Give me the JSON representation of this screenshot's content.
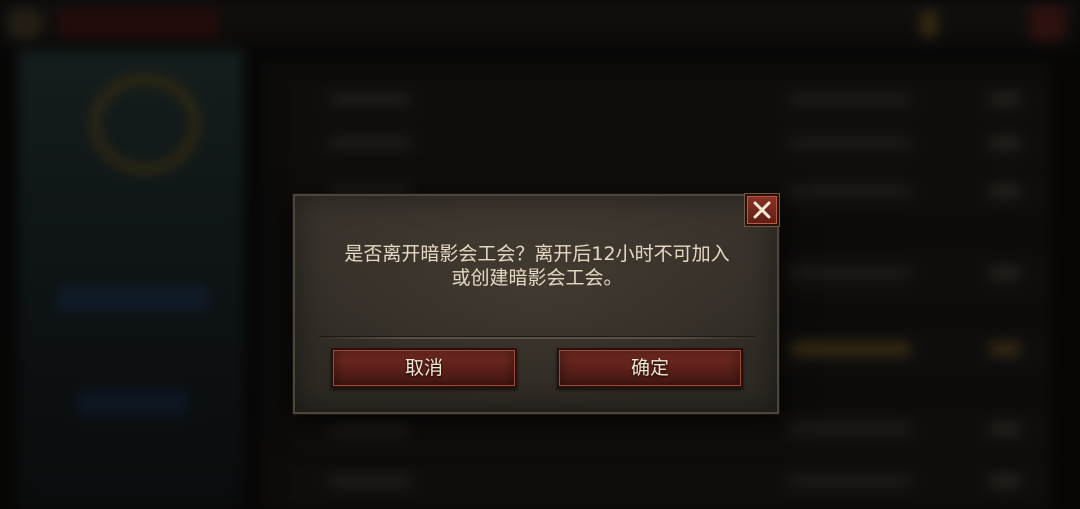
{
  "dialog": {
    "message_line1": "是否离开暗影会工会？离开后12小时不可加入",
    "message_line2": "或创建暗影会工会。",
    "cancel_label": "取消",
    "confirm_label": "确定"
  },
  "icons": {
    "close": "close-icon"
  },
  "colors": {
    "button_red": "#6a2720",
    "text_cream": "#e6d9c4",
    "panel_brown": "#332e28"
  }
}
